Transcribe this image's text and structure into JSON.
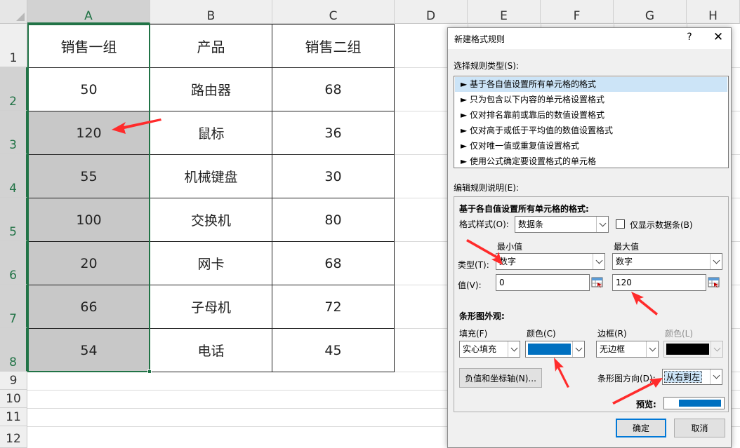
{
  "colors": {
    "accent": "#217346",
    "bar_color": "#0070c0",
    "border_color": "#000000",
    "arrow": "#ff2b2b"
  },
  "sheet": {
    "columns": [
      "A",
      "B",
      "C",
      "D",
      "E",
      "F",
      "G",
      "H"
    ],
    "rows": [
      "1",
      "2",
      "3",
      "4",
      "5",
      "6",
      "7",
      "8",
      "9",
      "10",
      "11",
      "12"
    ],
    "headers": [
      "销售一组",
      "产品",
      "销售二组"
    ],
    "data": [
      [
        "50",
        "路由器",
        "68"
      ],
      [
        "120",
        "鼠标",
        "36"
      ],
      [
        "55",
        "机械键盘",
        "30"
      ],
      [
        "100",
        "交换机",
        "80"
      ],
      [
        "20",
        "网卡",
        "68"
      ],
      [
        "66",
        "子母机",
        "72"
      ],
      [
        "54",
        "电话",
        "45"
      ]
    ]
  },
  "dialog": {
    "title": "新建格式规则",
    "help": "?",
    "close": "✕",
    "rule_type_label": "选择规则类型(S):",
    "rule_types": [
      "► 基于各自值设置所有单元格的格式",
      "► 只为包含以下内容的单元格设置格式",
      "► 仅对排名靠前或靠后的数值设置格式",
      "► 仅对高于或低于平均值的数值设置格式",
      "► 仅对唯一值或重复值设置格式",
      "► 使用公式确定要设置格式的单元格"
    ],
    "edit_label": "编辑规则说明(E):",
    "section_title": "基于各自值设置所有单元格的格式:",
    "format_style_label": "格式样式(O):",
    "format_style_value": "数据条",
    "show_bar_only_label": "仅显示数据条(B)",
    "min_label": "最小值",
    "max_label": "最大值",
    "type_label": "类型(T):",
    "min_type": "数字",
    "max_type": "数字",
    "value_label": "值(V):",
    "min_value": "0",
    "max_value": "120",
    "bar_appearance_label": "条形图外观:",
    "fill_label": "填充(F)",
    "color_label": "颜色(C)",
    "border_label": "边框(R)",
    "border_color_label": "颜色(L)",
    "fill_value": "实心填充",
    "border_value": "无边框",
    "negative_button": "负值和坐标轴(N)...",
    "direction_label": "条形图方向(D):",
    "direction_value": "从右到左",
    "preview_label": "预览:",
    "ok": "确定",
    "cancel": "取消"
  }
}
